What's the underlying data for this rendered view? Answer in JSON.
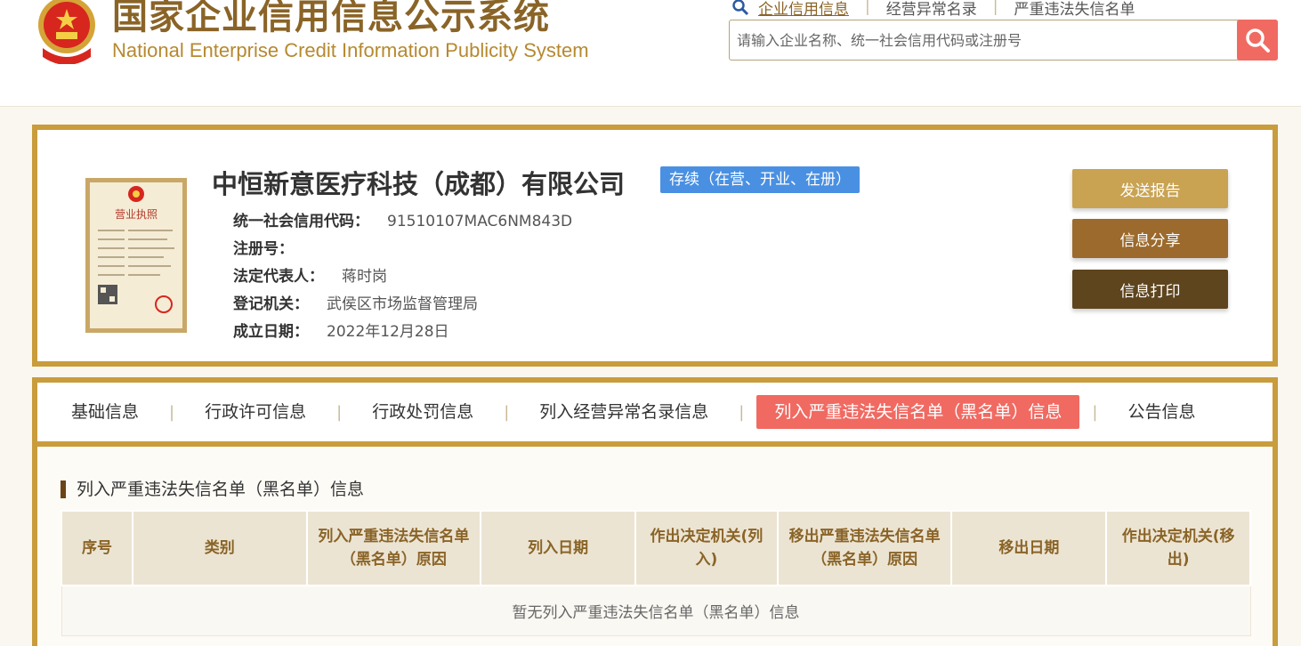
{
  "header": {
    "title_cn": "国家企业信用信息公示系统",
    "title_en": "National Enterprise Credit Information Publicity System",
    "nav": [
      {
        "label": "企业信用信息"
      },
      {
        "label": "经营异常名录"
      },
      {
        "label": "严重违法失信名单"
      }
    ],
    "search_placeholder": "请输入企业名称、统一社会信用代码或注册号"
  },
  "company": {
    "name": "中恒新意医疗科技（成都）有限公司",
    "status": "存续（在营、开业、在册）",
    "license_image_text": "营业执照",
    "fields": [
      {
        "label": "统一社会信用代码：",
        "value": "91510107MAC6NM843D"
      },
      {
        "label": "注册号：",
        "value": ""
      },
      {
        "label": "法定代表人：",
        "value": "蒋时岗"
      },
      {
        "label": "登记机关：",
        "value": "武侯区市场监督管理局"
      },
      {
        "label": "成立日期：",
        "value": "2022年12月28日"
      }
    ],
    "actions": [
      {
        "label": "发送报告"
      },
      {
        "label": "信息分享"
      },
      {
        "label": "信息打印"
      }
    ]
  },
  "tabs": [
    {
      "label": "基础信息"
    },
    {
      "label": "行政许可信息"
    },
    {
      "label": "行政处罚信息"
    },
    {
      "label": "列入经营异常名录信息"
    },
    {
      "label": "列入严重违法失信名单（黑名单）信息"
    },
    {
      "label": "公告信息"
    }
  ],
  "section": {
    "title": "列入严重违法失信名单（黑名单）信息",
    "columns": [
      "序号",
      "类别",
      "列入严重违法失信名单（黑名单）原因",
      "列入日期",
      "作出决定机关(列入)",
      "移出严重违法失信名单（黑名单）原因",
      "移出日期",
      "作出决定机关(移出)"
    ],
    "empty_text": "暂无列入严重违法失信名单（黑名单）信息"
  },
  "colors": {
    "gold_border": "#c99c3c",
    "accent_red": "#f06a62",
    "status_blue": "#4a90e2",
    "btn_gold": "#c9a352",
    "btn_brown": "#9b6a2c",
    "btn_dark": "#5e451e"
  }
}
